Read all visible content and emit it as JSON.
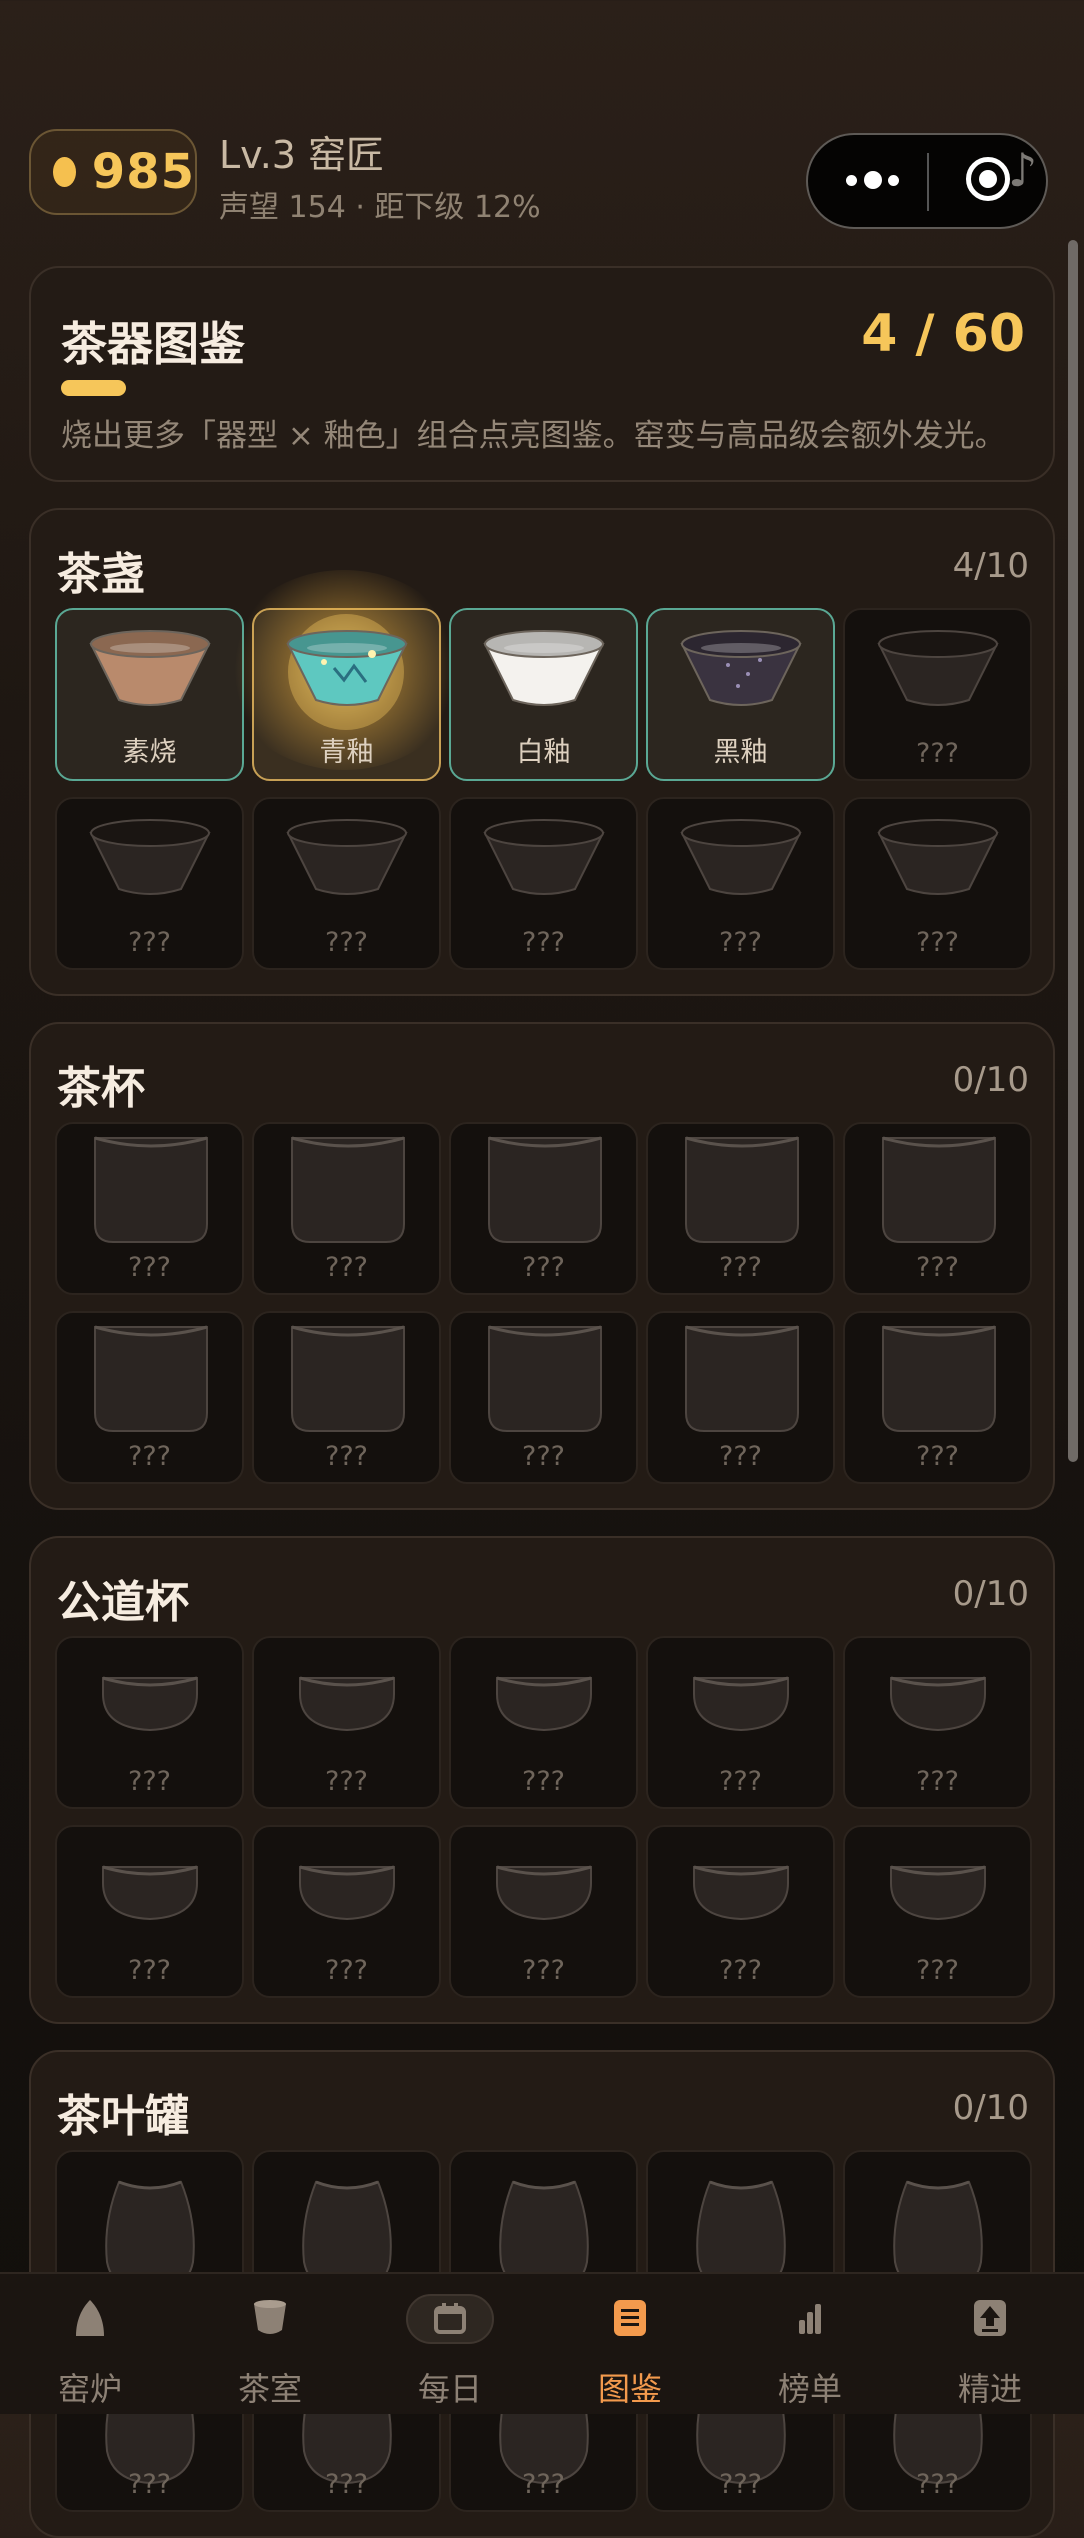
{
  "header": {
    "coins": "985",
    "level_title": "Lv.3 窑匠",
    "level_sub": "声望 154 · 距下级 12%",
    "capsule_menu_icon": "more-dots-icon",
    "capsule_record_icon": "record-target-icon"
  },
  "summary": {
    "title": "茶器图鉴",
    "count": "4 / 60",
    "progress": 0.067,
    "description": "烧出更多「器型 × 釉色」组合点亮图鉴。窑变与高品级会额外发光。"
  },
  "sections": [
    {
      "key": "bowl",
      "title": "茶盏",
      "count": "4/10",
      "items": [
        {
          "label": "素烧",
          "state": "found",
          "glaze": "#b98a6c"
        },
        {
          "label": "青釉",
          "state": "rare",
          "glaze": "#5ec8c0"
        },
        {
          "label": "白釉",
          "state": "found",
          "glaze": "#f4f2ee"
        },
        {
          "label": "黑釉",
          "state": "found",
          "glaze": "#3a3340"
        },
        {
          "label": "???",
          "state": "locked"
        },
        {
          "label": "???",
          "state": "locked"
        },
        {
          "label": "???",
          "state": "locked"
        },
        {
          "label": "???",
          "state": "locked"
        },
        {
          "label": "???",
          "state": "locked"
        },
        {
          "label": "???",
          "state": "locked"
        }
      ]
    },
    {
      "key": "cup",
      "title": "茶杯",
      "count": "0/10",
      "items": [
        {
          "label": "???",
          "state": "locked"
        },
        {
          "label": "???",
          "state": "locked"
        },
        {
          "label": "???",
          "state": "locked"
        },
        {
          "label": "???",
          "state": "locked"
        },
        {
          "label": "???",
          "state": "locked"
        },
        {
          "label": "???",
          "state": "locked"
        },
        {
          "label": "???",
          "state": "locked"
        },
        {
          "label": "???",
          "state": "locked"
        },
        {
          "label": "???",
          "state": "locked"
        },
        {
          "label": "???",
          "state": "locked"
        }
      ]
    },
    {
      "key": "pitcher",
      "title": "公道杯",
      "count": "0/10",
      "items": [
        {
          "label": "???",
          "state": "locked"
        },
        {
          "label": "???",
          "state": "locked"
        },
        {
          "label": "???",
          "state": "locked"
        },
        {
          "label": "???",
          "state": "locked"
        },
        {
          "label": "???",
          "state": "locked"
        },
        {
          "label": "???",
          "state": "locked"
        },
        {
          "label": "???",
          "state": "locked"
        },
        {
          "label": "???",
          "state": "locked"
        },
        {
          "label": "???",
          "state": "locked"
        },
        {
          "label": "???",
          "state": "locked"
        }
      ]
    },
    {
      "key": "jar",
      "title": "茶叶罐",
      "count": "0/10",
      "items": [
        {
          "label": "???",
          "state": "locked"
        },
        {
          "label": "???",
          "state": "locked"
        },
        {
          "label": "???",
          "state": "locked"
        },
        {
          "label": "???",
          "state": "locked"
        },
        {
          "label": "???",
          "state": "locked"
        },
        {
          "label": "???",
          "state": "locked"
        },
        {
          "label": "???",
          "state": "locked"
        },
        {
          "label": "???",
          "state": "locked"
        },
        {
          "label": "???",
          "state": "locked"
        },
        {
          "label": "???",
          "state": "locked"
        }
      ]
    }
  ],
  "tabs": [
    {
      "label": "窑炉",
      "icon": "kiln-icon",
      "active": false
    },
    {
      "label": "茶室",
      "icon": "tea-cup-icon",
      "active": false
    },
    {
      "label": "每日",
      "icon": "calendar-icon",
      "active": false
    },
    {
      "label": "图鉴",
      "icon": "catalog-icon",
      "active": true
    },
    {
      "label": "榜单",
      "icon": "ranking-icon",
      "active": false
    },
    {
      "label": "精进",
      "icon": "upgrade-icon",
      "active": false
    }
  ],
  "colors": {
    "accent_gold": "#f6c65a",
    "found_border": "#5aa894",
    "active_tab": "#f39a4d"
  }
}
